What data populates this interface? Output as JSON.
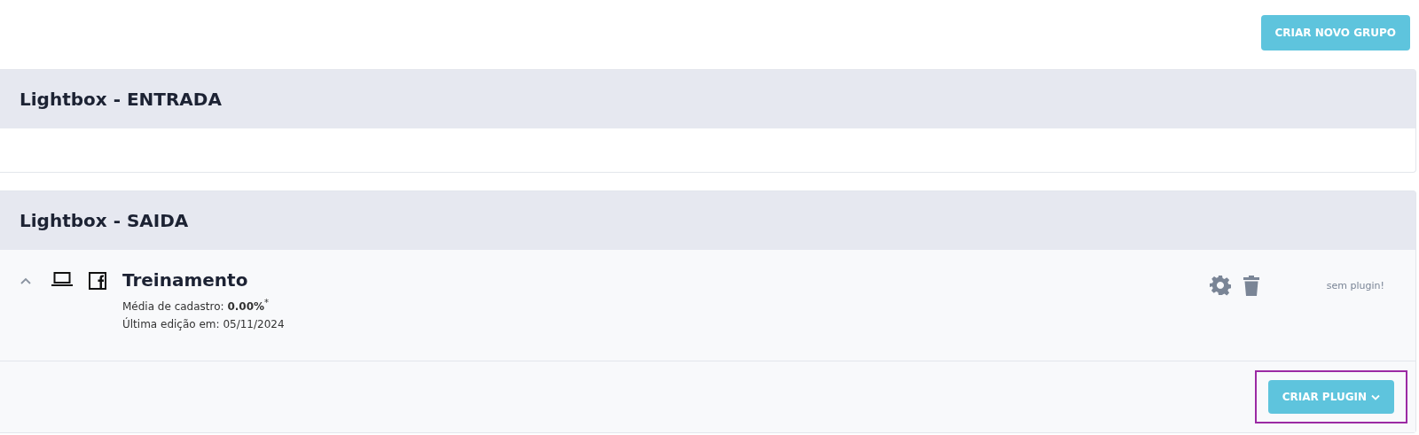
{
  "create_group_button": "CRIAR NOVO GRUPO",
  "groups": [
    {
      "title": "Lightbox - ENTRADA"
    },
    {
      "title": "Lightbox - SAIDA",
      "items": [
        {
          "name": "Treinamento",
          "expanded": true,
          "average": "Média de cadastro: **0.00%**$^{*}$",
          "edited": "Última edição em: 05/11/2024",
          "status": "sem plugin!"
        }
      ],
      "create_plugin_button": "CRIAR PLUGIN",
      "highlighted": true
    }
  ]
}
